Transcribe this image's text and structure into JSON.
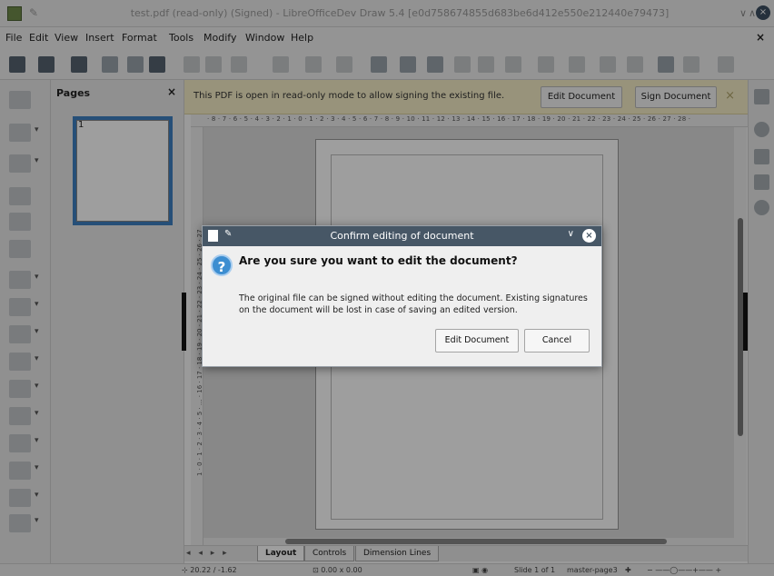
{
  "window": {
    "title": "test.pdf (read-only) (Signed) - LibreOfficeDev Draw 5.4 [e0d758674855d683be6d412e550e212440e79473]"
  },
  "menubar": {
    "items": [
      "File",
      "Edit",
      "View",
      "Insert",
      "Format",
      "Tools",
      "Modify",
      "Window",
      "Help"
    ],
    "close_symbol": "×"
  },
  "slide_pane": {
    "title": "Pages",
    "close_symbol": "×",
    "thumbnail_number": "1"
  },
  "infobar": {
    "message": "This PDF is open in read-only mode to allow signing the existing file.",
    "edit_button": "Edit Document",
    "sign_button": "Sign Document",
    "close_symbol": "×"
  },
  "ruler": {
    "horizontal": "· 8 · 7 · 6 · 5 · 4 · 3 · 2 · 1 · 0 · 1 · 2 · 3 · 4 · 5 · 6 · 7 · 8 · 9 · 10 · 11 · 12 · 13 · 14 · 15 · 16 · 17 · 18 · 19 · 20 · 21 · 22 · 23 · 24 · 25 · 26 · 27 · 28 ·",
    "vertical": "1 · 0 · 1 · 2 · 3 · 4 · 5 · ... · 16 · 17 · 18 · 19 · 20 · 21 · 22 · 23 · 24 · 25 · 26 · 27"
  },
  "tabs": [
    "Layout",
    "Controls",
    "Dimension Lines"
  ],
  "tab_nav": "◂ ◂ ▸ ▸",
  "statusbar": {
    "position": "20.22 / -1.62",
    "size": "0.00 x 0.00",
    "slide": "Slide 1 of 1",
    "master": "master-page3"
  },
  "dialog": {
    "title": "Confirm editing of document",
    "heading": "Are you sure you want to edit the document?",
    "body": "The original file can be signed without editing the document. Existing signatures on the document will be lost in case of saving an edited version.",
    "edit_button": "Edit Document",
    "cancel_button": "Cancel",
    "close_symbol": "×",
    "question_symbol": "?"
  }
}
